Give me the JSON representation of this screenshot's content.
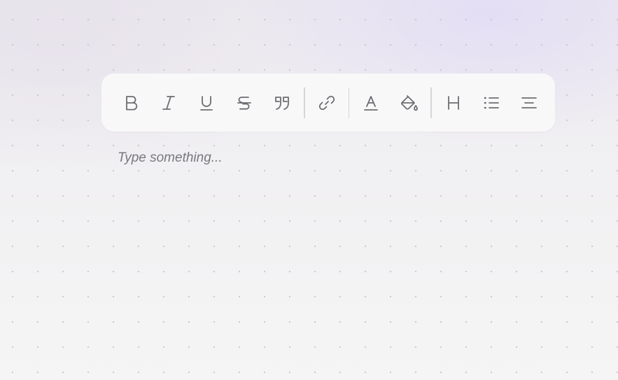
{
  "toolbar": {
    "buttons": [
      {
        "name": "bold",
        "icon": "bold-icon"
      },
      {
        "name": "italic",
        "icon": "italic-icon"
      },
      {
        "name": "underline",
        "icon": "underline-icon"
      },
      {
        "name": "strikethrough",
        "icon": "strikethrough-icon"
      },
      {
        "name": "quote",
        "icon": "quote-icon"
      },
      {
        "name": "link",
        "icon": "link-icon"
      },
      {
        "name": "text-color",
        "icon": "text-color-icon"
      },
      {
        "name": "highlight",
        "icon": "paint-bucket-icon"
      },
      {
        "name": "heading",
        "icon": "heading-icon"
      },
      {
        "name": "bullet-list",
        "icon": "list-icon"
      },
      {
        "name": "align",
        "icon": "align-center-icon"
      }
    ],
    "icon_color": "#6e6c72"
  },
  "editor": {
    "placeholder": "Type something..."
  }
}
